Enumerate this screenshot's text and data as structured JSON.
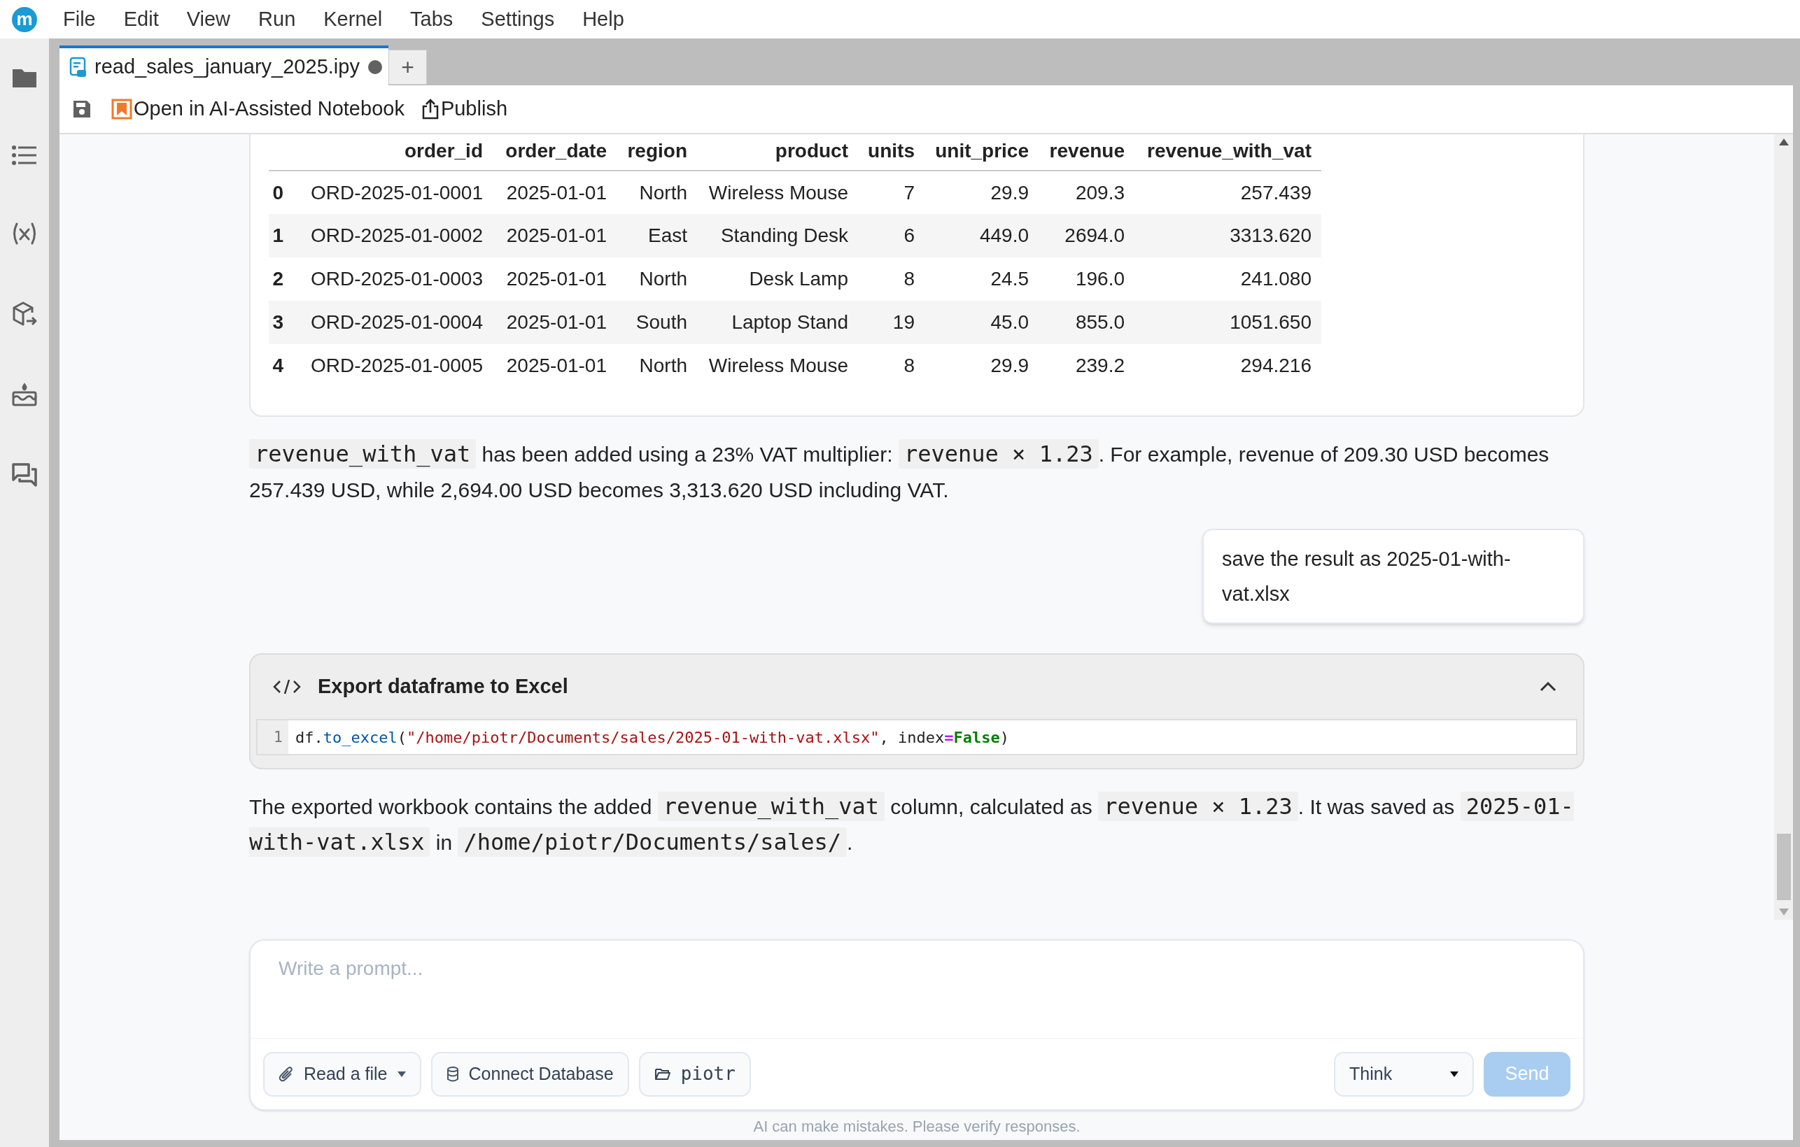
{
  "logo": "m",
  "menu": [
    "File",
    "Edit",
    "View",
    "Run",
    "Kernel",
    "Tabs",
    "Settings",
    "Help"
  ],
  "tabs": [
    {
      "label": "read_sales_january_2025.ipy",
      "selected": true,
      "unsaved": true
    }
  ],
  "new_tab": "+",
  "toolbar": [
    {
      "kind": "save"
    },
    {
      "kind": "ai",
      "label": "Open in AI-Assisted Notebook"
    },
    {
      "kind": "publish",
      "label": "Publish"
    }
  ],
  "table": {
    "columns": [
      "",
      "order_id",
      "order_date",
      "region",
      "product",
      "units",
      "unit_price",
      "revenue",
      "revenue_with_vat"
    ],
    "rows": [
      [
        "0",
        "ORD-2025-01-0001",
        "2025-01-01",
        "North",
        "Wireless Mouse",
        "7",
        "29.9",
        "209.3",
        "257.439"
      ],
      [
        "1",
        "ORD-2025-01-0002",
        "2025-01-01",
        "East",
        "Standing Desk",
        "6",
        "449.0",
        "2694.0",
        "3313.620"
      ],
      [
        "2",
        "ORD-2025-01-0003",
        "2025-01-01",
        "North",
        "Desk Lamp",
        "8",
        "24.5",
        "196.0",
        "241.080"
      ],
      [
        "3",
        "ORD-2025-01-0004",
        "2025-01-01",
        "South",
        "Laptop Stand",
        "19",
        "45.0",
        "855.0",
        "1051.650"
      ],
      [
        "4",
        "ORD-2025-01-0005",
        "2025-01-01",
        "North",
        "Wireless Mouse",
        "8",
        "29.9",
        "239.2",
        "294.216"
      ]
    ]
  },
  "messages": [
    {
      "kind": "assistant",
      "parts": [
        {
          "kind": "code",
          "text": "revenue_with_vat"
        },
        {
          "kind": "text",
          "text": " has been added using a 23% VAT multiplier: "
        },
        {
          "kind": "code",
          "text": "revenue × 1.23"
        },
        {
          "kind": "text",
          "text": ". For example, revenue of 209.30 USD becomes 257.439 USD, while 2,694.00 USD becomes 3,313.620 USD including VAT."
        }
      ]
    },
    {
      "kind": "user",
      "text": "save the result as 2025-01-with-vat.xlsx"
    },
    {
      "kind": "tool",
      "title": "Export dataframe to Excel",
      "expanded": true,
      "line_number": "1",
      "tokens": [
        {
          "kind": "plain",
          "text": "df."
        },
        {
          "kind": "method",
          "text": "to_excel"
        },
        {
          "kind": "plain",
          "text": "("
        },
        {
          "kind": "string",
          "text": "\"/home/piotr/Documents/sales/2025-01-with-vat.xlsx\""
        },
        {
          "kind": "plain",
          "text": ", index"
        },
        {
          "kind": "operator",
          "text": "="
        },
        {
          "kind": "keyword",
          "text": "False"
        },
        {
          "kind": "plain",
          "text": ")"
        }
      ]
    },
    {
      "kind": "assistant",
      "parts": [
        {
          "kind": "text",
          "text": "The exported workbook contains the added "
        },
        {
          "kind": "code",
          "text": "revenue_with_vat"
        },
        {
          "kind": "text",
          "text": " column, calculated as "
        },
        {
          "kind": "code",
          "text": "revenue × 1.23"
        },
        {
          "kind": "text",
          "text": ". It was saved as "
        },
        {
          "kind": "code",
          "text": "2025-01-with-vat.xlsx"
        },
        {
          "kind": "text",
          "text": " in "
        },
        {
          "kind": "code",
          "text": "/home/piotr/Documents/sales/"
        },
        {
          "kind": "text",
          "text": "."
        }
      ]
    }
  ],
  "prompt": {
    "placeholder": "Write a prompt...",
    "buttons": [
      {
        "kind": "file",
        "label": "Read a file"
      },
      {
        "kind": "database",
        "label": "Connect Database"
      },
      {
        "kind": "folder",
        "label": "piotr"
      }
    ],
    "mode": "Think",
    "send": {
      "label": "Send",
      "disabled": true
    }
  },
  "footer": "AI can make mistakes. Please verify responses."
}
